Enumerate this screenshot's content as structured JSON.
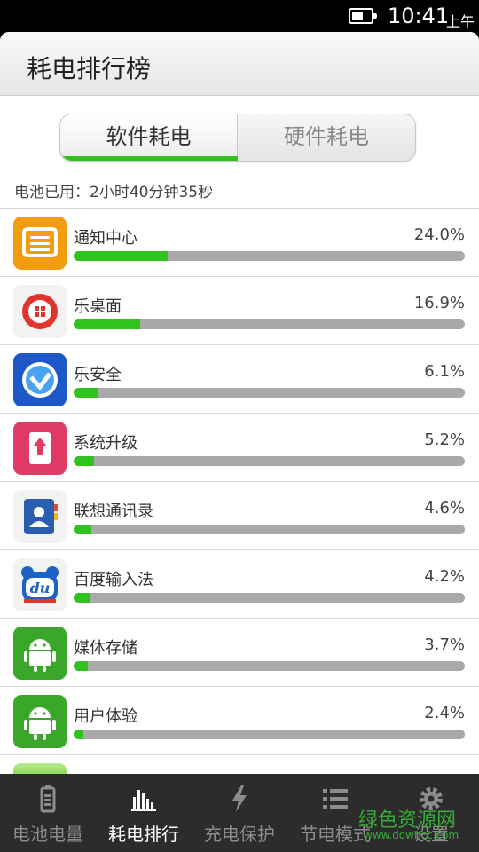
{
  "status_bar": {
    "time": "10:41",
    "ampm": "上午",
    "battery_level": 0.6
  },
  "header": {
    "title": "耗电排行榜"
  },
  "segments": {
    "active_label": "软件耗电",
    "inactive_label": "硬件耗电"
  },
  "battery_used": "电池已用：2小时40分钟35秒",
  "apps": [
    {
      "name": "通知中心",
      "percent_text": "24.0%",
      "percent": 24.0,
      "icon": "notification-center-icon",
      "color": "#f39c12"
    },
    {
      "name": "乐桌面",
      "percent_text": "16.9%",
      "percent": 16.9,
      "icon": "le-desktop-icon",
      "color": "#e0342c"
    },
    {
      "name": "乐安全",
      "percent_text": "6.1%",
      "percent": 6.1,
      "icon": "le-security-icon",
      "color": "#1e58c8"
    },
    {
      "name": "系统升级",
      "percent_text": "5.2%",
      "percent": 5.2,
      "icon": "system-upgrade-icon",
      "color": "#e03a66"
    },
    {
      "name": "联想通讯录",
      "percent_text": "4.6%",
      "percent": 4.6,
      "icon": "contacts-icon",
      "color": "#2a5fb0"
    },
    {
      "name": "百度输入法",
      "percent_text": "4.2%",
      "percent": 4.2,
      "icon": "baidu-ime-icon",
      "color": "#1b63c4"
    },
    {
      "name": "媒体存储",
      "percent_text": "3.7%",
      "percent": 3.7,
      "icon": "android-icon",
      "color": "#3aa72b"
    },
    {
      "name": "用户体验",
      "percent_text": "2.4%",
      "percent": 2.4,
      "icon": "android-icon",
      "color": "#3aa72b"
    }
  ],
  "tabbar": {
    "tabs": [
      {
        "label": "电池电量",
        "icon": "battery-icon",
        "active": false
      },
      {
        "label": "耗电排行",
        "icon": "bar-chart-icon",
        "active": true
      },
      {
        "label": "充电保护",
        "icon": "lightning-icon",
        "active": false
      },
      {
        "label": "节电模式",
        "icon": "list-icon",
        "active": false
      },
      {
        "label": "设置",
        "icon": "gear-icon",
        "active": false
      }
    ]
  },
  "watermark": {
    "text": "绿色资源网",
    "sub": "www.downcc.com"
  }
}
